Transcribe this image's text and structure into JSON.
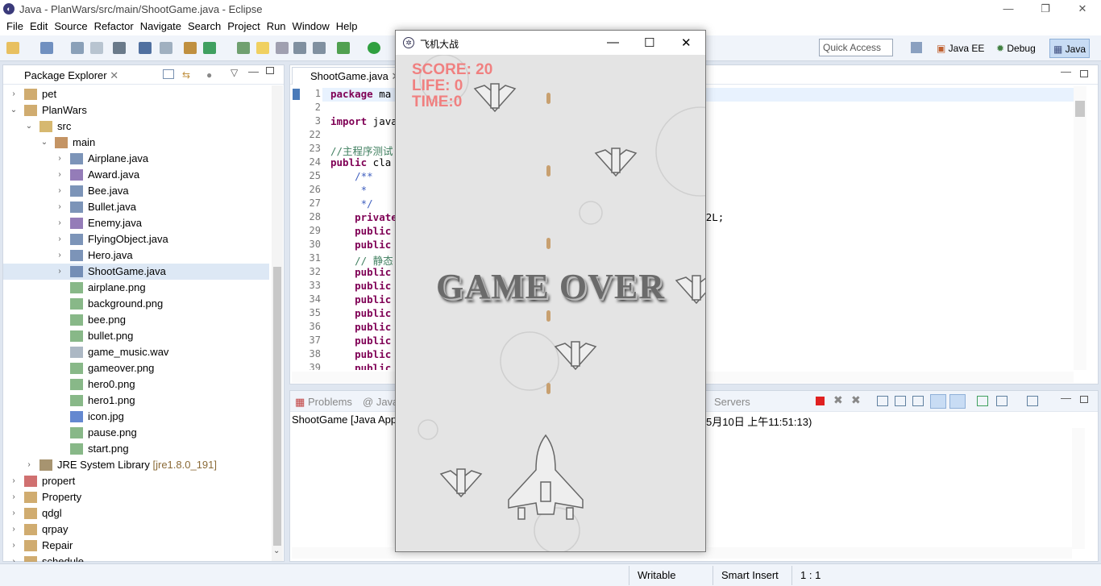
{
  "window": {
    "title": "Java - PlanWars/src/main/ShootGame.java - Eclipse",
    "controls": [
      "—",
      "❐",
      "✕"
    ]
  },
  "menu": [
    "File",
    "Edit",
    "Source",
    "Refactor",
    "Navigate",
    "Search",
    "Project",
    "Run",
    "Window",
    "Help"
  ],
  "toolbar": {
    "quick_access": "Quick Access",
    "perspectives": [
      "Java EE",
      "Debug",
      "Java"
    ]
  },
  "package_explorer": {
    "title": "Package Explorer",
    "items": [
      {
        "label": "pet",
        "arrow": "›",
        "icon": "project-icon"
      },
      {
        "label": "PlanWars",
        "arrow": "⌄",
        "icon": "project-icon"
      },
      {
        "label": "src",
        "arrow": "⌄",
        "icon": "source-folder-icon"
      },
      {
        "label": "main",
        "arrow": "⌄",
        "icon": "package-icon"
      },
      {
        "label": "Airplane.java",
        "arrow": "›",
        "icon": "java-file-icon"
      },
      {
        "label": "Award.java",
        "arrow": "›",
        "icon": "java-interface-icon"
      },
      {
        "label": "Bee.java",
        "arrow": "›",
        "icon": "java-file-icon"
      },
      {
        "label": "Bullet.java",
        "arrow": "›",
        "icon": "java-file-icon"
      },
      {
        "label": "Enemy.java",
        "arrow": "›",
        "icon": "java-interface-icon"
      },
      {
        "label": "FlyingObject.java",
        "arrow": "›",
        "icon": "java-file-icon"
      },
      {
        "label": "Hero.java",
        "arrow": "›",
        "icon": "java-file-icon"
      },
      {
        "label": "ShootGame.java",
        "arrow": "›",
        "icon": "java-file-icon"
      },
      {
        "label": "airplane.png",
        "arrow": "",
        "icon": "png-icon"
      },
      {
        "label": "background.png",
        "arrow": "",
        "icon": "png-icon"
      },
      {
        "label": "bee.png",
        "arrow": "",
        "icon": "png-icon"
      },
      {
        "label": "bullet.png",
        "arrow": "",
        "icon": "png-icon"
      },
      {
        "label": "game_music.wav",
        "arrow": "",
        "icon": "file-icon"
      },
      {
        "label": "gameover.png",
        "arrow": "",
        "icon": "png-icon"
      },
      {
        "label": "hero0.png",
        "arrow": "",
        "icon": "png-icon"
      },
      {
        "label": "hero1.png",
        "arrow": "",
        "icon": "png-icon"
      },
      {
        "label": "icon.jpg",
        "arrow": "",
        "icon": "jpg-icon"
      },
      {
        "label": "pause.png",
        "arrow": "",
        "icon": "png-icon"
      },
      {
        "label": "start.png",
        "arrow": "",
        "icon": "png-icon"
      },
      {
        "label": "JRE System Library",
        "deco": "[jre1.8.0_191]",
        "arrow": "›",
        "icon": "library-icon"
      },
      {
        "label": "propert",
        "arrow": "›",
        "icon": "project-error-icon"
      },
      {
        "label": "Property",
        "arrow": "›",
        "icon": "project-icon"
      },
      {
        "label": "qdgl",
        "arrow": "›",
        "icon": "project-icon"
      },
      {
        "label": "qrpay",
        "arrow": "›",
        "icon": "project-icon"
      },
      {
        "label": "Repair",
        "arrow": "›",
        "icon": "project-icon"
      },
      {
        "label": "schedule",
        "arrow": "›",
        "icon": "project-icon"
      }
    ]
  },
  "editor": {
    "tab": "ShootGame.java",
    "lines": [
      {
        "n": "1",
        "cls": "",
        "segs": [
          [
            "kw",
            "package"
          ],
          [
            "",
            " ma"
          ]
        ]
      },
      {
        "n": "2",
        "cls": "",
        "segs": []
      },
      {
        "n": "3",
        "cls": "",
        "segs": [
          [
            "kw",
            "import"
          ],
          [
            "",
            " java"
          ]
        ]
      },
      {
        "n": "22",
        "cls": "",
        "segs": []
      },
      {
        "n": "23",
        "cls": "",
        "segs": [
          [
            "cm",
            "//主程序测试"
          ]
        ]
      },
      {
        "n": "24",
        "cls": "",
        "segs": [
          [
            "kw",
            "public"
          ],
          [
            "",
            " cla"
          ]
        ]
      },
      {
        "n": "25",
        "cls": "",
        "segs": [
          [
            "jd",
            "    /**"
          ]
        ]
      },
      {
        "n": "26",
        "cls": "",
        "segs": [
          [
            "jd",
            "     *"
          ]
        ]
      },
      {
        "n": "27",
        "cls": "",
        "segs": [
          [
            "jd",
            "     */"
          ]
        ]
      },
      {
        "n": "28",
        "cls": "",
        "segs": [
          [
            "kw",
            "    private"
          ]
        ]
      },
      {
        "n": "29",
        "cls": "",
        "segs": [
          [
            "kw",
            "    public"
          ]
        ]
      },
      {
        "n": "30",
        "cls": "",
        "segs": [
          [
            "kw",
            "    public"
          ]
        ]
      },
      {
        "n": "31",
        "cls": "",
        "segs": [
          [
            "cm",
            "    // 静态"
          ]
        ]
      },
      {
        "n": "32",
        "cls": "",
        "segs": [
          [
            "kw",
            "    public"
          ]
        ]
      },
      {
        "n": "33",
        "cls": "",
        "segs": [
          [
            "kw",
            "    public"
          ]
        ]
      },
      {
        "n": "34",
        "cls": "",
        "segs": [
          [
            "kw",
            "    public"
          ]
        ]
      },
      {
        "n": "35",
        "cls": "",
        "segs": [
          [
            "kw",
            "    public"
          ]
        ]
      },
      {
        "n": "36",
        "cls": "",
        "segs": [
          [
            "kw",
            "    public"
          ]
        ]
      },
      {
        "n": "37",
        "cls": "",
        "segs": [
          [
            "kw",
            "    public"
          ]
        ]
      },
      {
        "n": "38",
        "cls": "",
        "segs": [
          [
            "kw",
            "    public"
          ]
        ]
      },
      {
        "n": "39",
        "cls": "",
        "segs": [
          [
            "kw",
            "    public"
          ]
        ]
      }
    ],
    "line28_tail": "8745581422L;"
  },
  "console": {
    "tabs": [
      "Problems",
      "Java",
      "Servers"
    ],
    "text_left": "ShootGame [Java App",
    "text_right": "5月10日 上午11:51:13)"
  },
  "status": {
    "writable": "Writable",
    "insert": "Smart Insert",
    "position": "1 : 1"
  },
  "game": {
    "title": "飞机大战",
    "controls": [
      "—",
      "☐",
      "✕"
    ],
    "score": "SCORE: 20",
    "life": "LIFE: 0",
    "time": "TIME:0",
    "gameover": "GAME OVER",
    "colors": {
      "hud": "#f08080",
      "background": "#e4e4e4"
    }
  }
}
